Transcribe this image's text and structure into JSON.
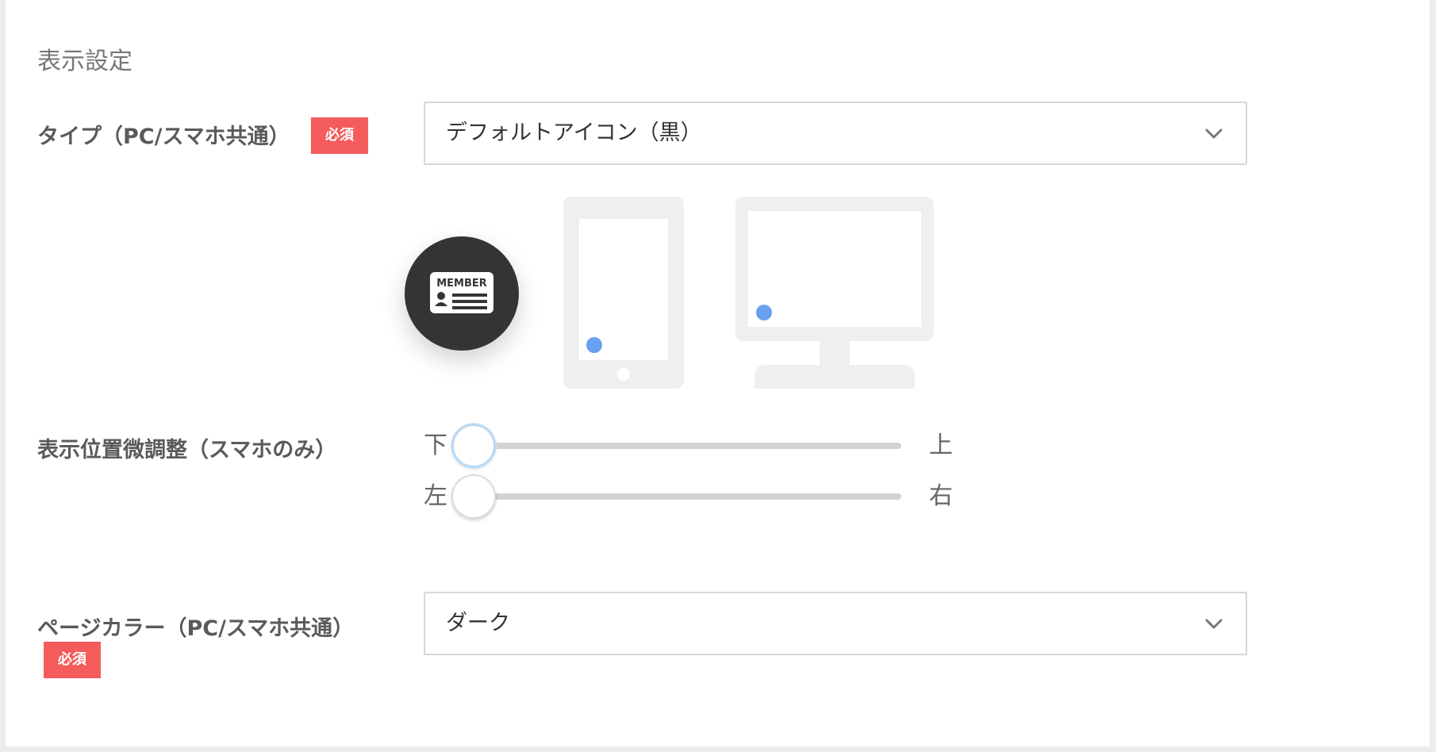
{
  "section": {
    "title": "表示設定"
  },
  "type_field": {
    "label": "タイプ（PC/スマホ共通）",
    "required_badge": "必須",
    "selected": "デフォルトアイコン（黒）"
  },
  "preview": {
    "member_icon_text": "MEMBER",
    "icon_name": "member-card-icon",
    "marker_color": "#6aa0f0"
  },
  "position_adjust": {
    "label": "表示位置微調整（スマホのみ）",
    "vertical": {
      "min_label": "下",
      "max_label": "上",
      "value_fraction": 0
    },
    "horizontal": {
      "min_label": "左",
      "max_label": "右",
      "value_fraction": 0
    }
  },
  "page_color_field": {
    "label": "ページカラー（PC/スマホ共通）",
    "required_badge": "必須",
    "selected": "ダーク"
  },
  "colors": {
    "badge": "#f45b5b",
    "icon_bg": "#343434",
    "device": "#efefef"
  }
}
